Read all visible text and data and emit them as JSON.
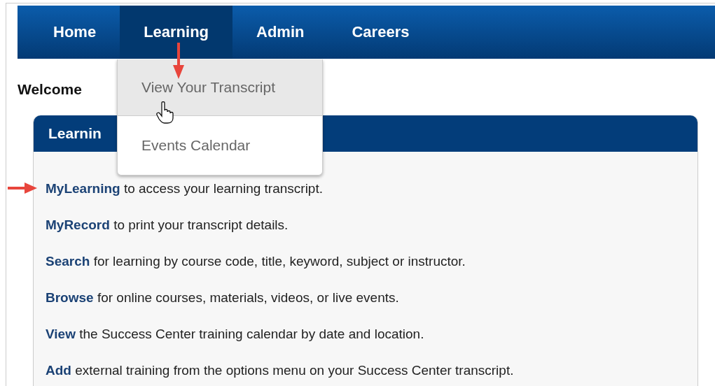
{
  "nav": {
    "tabs": [
      {
        "label": "Home",
        "selected": false
      },
      {
        "label": "Learning",
        "selected": true
      },
      {
        "label": "Admin",
        "selected": false
      },
      {
        "label": "Careers",
        "selected": false
      }
    ]
  },
  "dropdown": {
    "items": [
      {
        "label": "View Your Transcript",
        "selected": true
      },
      {
        "label": "Events Calendar",
        "selected": false
      }
    ]
  },
  "welcome": "Welcome",
  "panel": {
    "title": "Learnin",
    "rows": [
      {
        "link": "MyLearning",
        "text": " to access your learning transcript."
      },
      {
        "link": "MyRecord",
        "text": " to print your transcript details."
      },
      {
        "link": "Search",
        "text": " for learning by course code, title, keyword, subject or instructor."
      },
      {
        "link": "Browse",
        "text": " for online courses, materials, videos, or live events."
      },
      {
        "link": "View",
        "text": " the Success Center training calendar by date and location."
      },
      {
        "link": "Add",
        "text": " external training from the options menu on your Success Center transcript."
      }
    ]
  }
}
